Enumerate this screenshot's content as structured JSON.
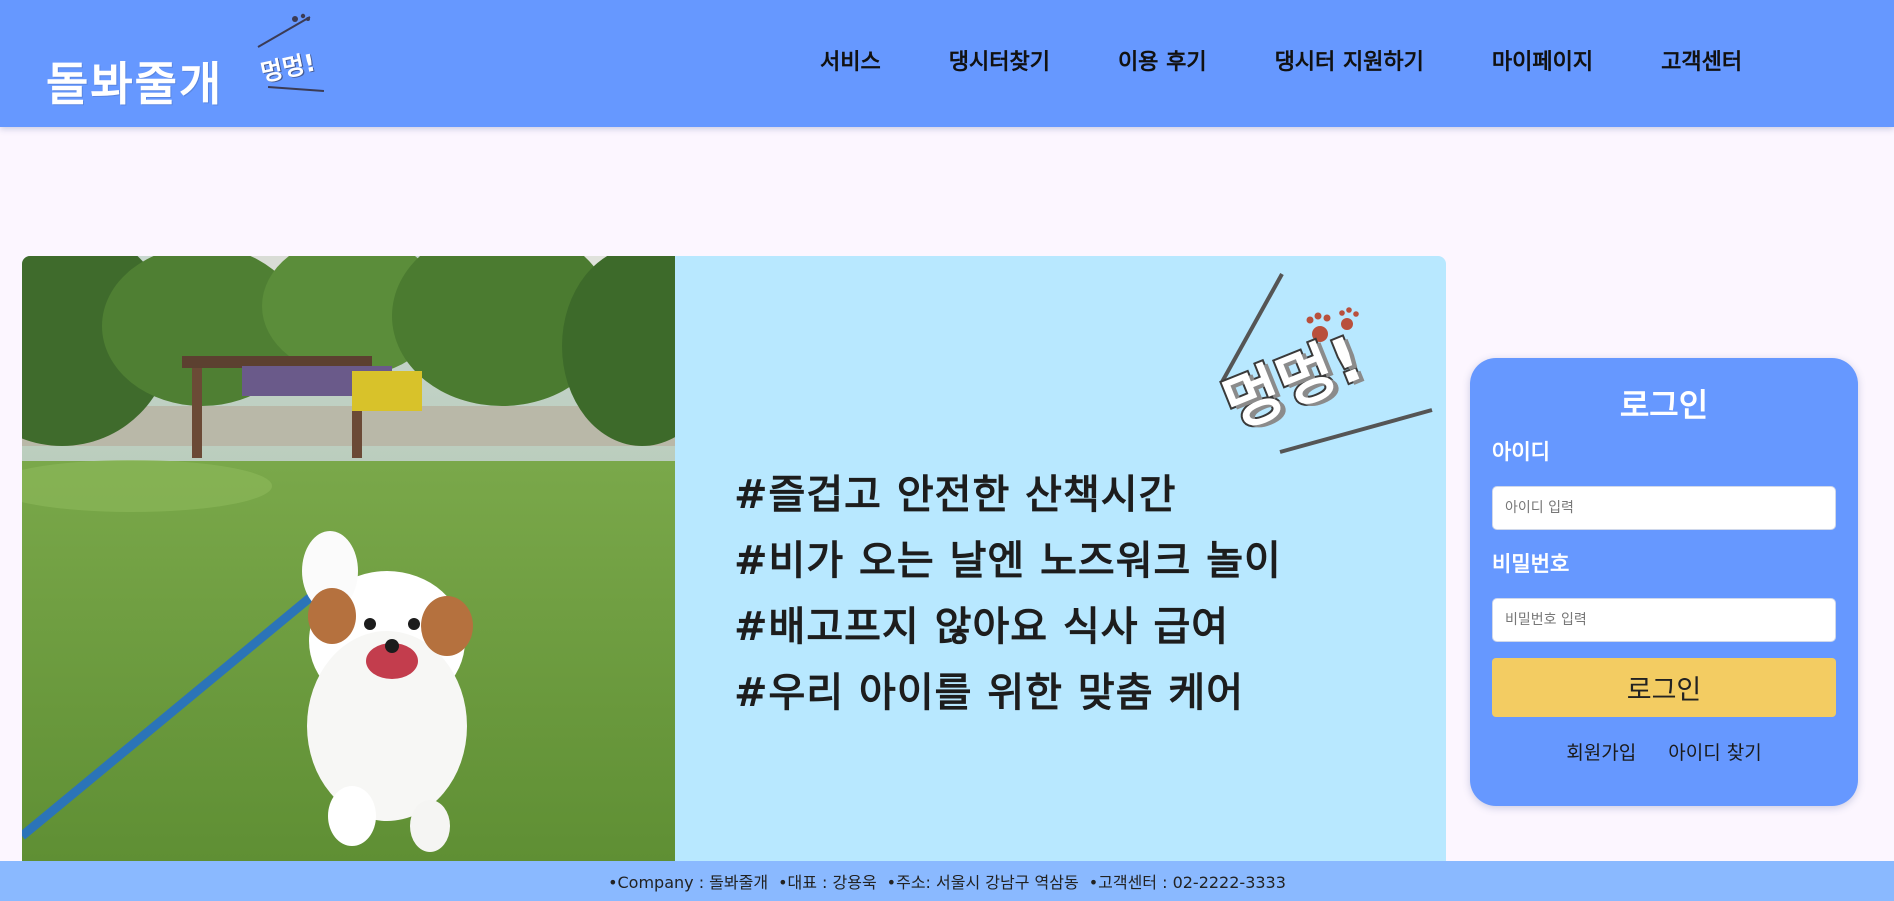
{
  "header": {
    "logo_main": "돌봐줄개",
    "logo_sub": "멍멍!",
    "nav": [
      "서비스",
      "댕시터찾기",
      "이용 후기",
      "댕시터 지원하기",
      "마이페이지",
      "고객센터"
    ]
  },
  "banner": {
    "badge": "멍멍!",
    "hashtags": [
      "#즐겁고 안전한 산책시간",
      "#비가 오는 날엔 노즈워크 놀이",
      "#배고프지 않아요 식사 급여",
      "#우리 아이를 위한 맞춤 케어"
    ]
  },
  "login": {
    "title": "로그인",
    "id_label": "아이디",
    "id_placeholder": "아이디 입력",
    "pw_label": "비밀번호",
    "pw_placeholder": "비밀번호 입력",
    "submit": "로그인",
    "links": [
      "회원가입",
      "아이디 찾기"
    ]
  },
  "footer": {
    "items": [
      "•Company : 돌봐줄개",
      "•대표 : 강용욱",
      "•주소: 서울시 강남구 역삼동",
      "•고객센터 : 02-2222-3333"
    ]
  },
  "colors": {
    "header": "#6698ff",
    "footer": "#8ab9ff",
    "banner_bg": "#b8e8ff",
    "button": "#f3cc62"
  }
}
